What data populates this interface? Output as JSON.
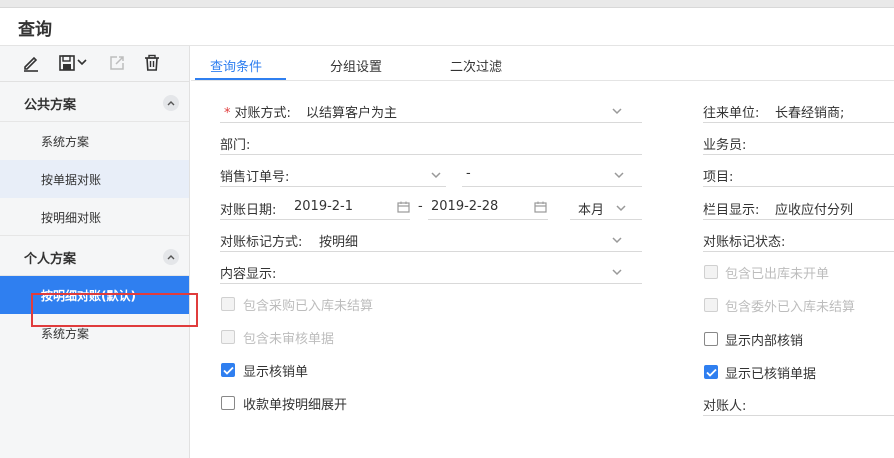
{
  "dialog": {
    "title": "查询"
  },
  "toolbar": {
    "icons": [
      "edit-icon",
      "save-icon",
      "dropdown-chevron-icon",
      "export-icon",
      "delete-icon"
    ]
  },
  "sidebar": {
    "public_group": {
      "title": "公共方案",
      "items": [
        "系统方案",
        "按单据对账",
        "按明细对账"
      ]
    },
    "personal_group": {
      "title": "个人方案",
      "items": [
        "按明细对账(默认)",
        "系统方案"
      ]
    }
  },
  "tabs": [
    "查询条件",
    "分组设置",
    "二次过滤"
  ],
  "form": {
    "recon_mode": {
      "label": "对账方式:",
      "value": "以结算客户为主"
    },
    "department": {
      "label": "部门:"
    },
    "sales_order": {
      "label": "销售订单号:",
      "separator": "-"
    },
    "recon_date": {
      "label": "对账日期:",
      "start": "2019-2-1",
      "separator": "-",
      "end": "2019-2-28",
      "period": "本月"
    },
    "recon_mark_mode": {
      "label": "对账标记方式:",
      "value": "按明细"
    },
    "content_display": {
      "label": "内容显示:"
    },
    "counterparty": {
      "label": "往来单位:",
      "value": "长春经销商;"
    },
    "salesperson": {
      "label": "业务员:"
    },
    "project": {
      "label": "项目:"
    },
    "column_display": {
      "label": "栏目显示:",
      "value": "应收应付分列"
    },
    "recon_mark_status": {
      "label": "对账标记状态:"
    },
    "reconciler": {
      "label": "对账人:"
    }
  },
  "checkboxes_left": [
    {
      "label": "包含采购已入库未结算",
      "checked": false,
      "disabled": true
    },
    {
      "label": "包含未审核单据",
      "checked": false,
      "disabled": true
    },
    {
      "label": "显示核销单",
      "checked": true,
      "disabled": false
    },
    {
      "label": "收款单按明细展开",
      "checked": false,
      "disabled": false
    }
  ],
  "checkboxes_right": [
    {
      "label": "包含已出库未开单",
      "checked": false,
      "disabled": true
    },
    {
      "label": "包含委外已入库未结算",
      "checked": false,
      "disabled": true
    },
    {
      "label": "显示内部核销",
      "checked": false,
      "disabled": false
    },
    {
      "label": "显示已核销单据",
      "checked": true,
      "disabled": false
    }
  ],
  "colors": {
    "accent": "#2f7ff0",
    "required": "#e03c3c",
    "annotation_box": "#e03c3c"
  }
}
